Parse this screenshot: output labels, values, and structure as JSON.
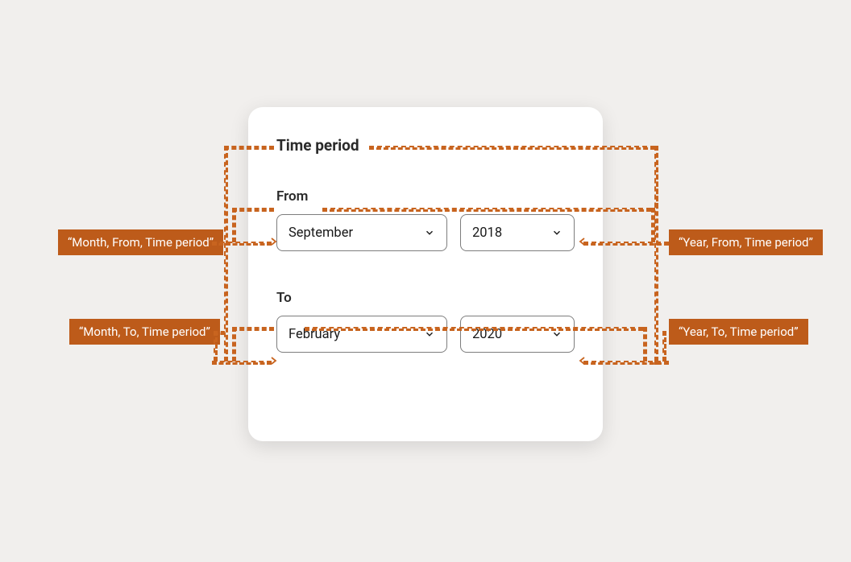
{
  "card": {
    "title": "Time period",
    "from": {
      "label": "From",
      "month": "September",
      "year": "2018"
    },
    "to": {
      "label": "To",
      "month": "February",
      "year": "2020"
    }
  },
  "annotations": {
    "from_month": "“Month, From, Time period”",
    "from_year": "“Year, From, Time period”",
    "to_month": "“Month, To, Time period”",
    "to_year": "“Year, To, Time period”"
  }
}
